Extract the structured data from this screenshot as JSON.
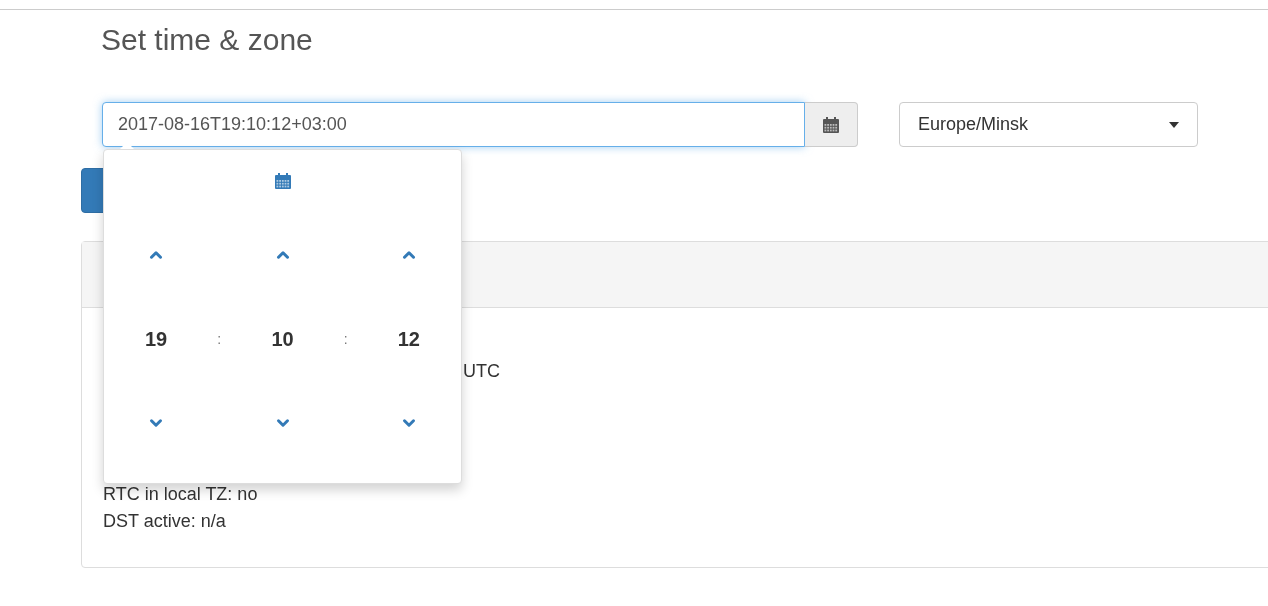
{
  "title": "Set time & zone",
  "datetime": {
    "value": "2017-08-16T19:10:12+03:00"
  },
  "timezone": {
    "value": "Europe/Minsk"
  },
  "picker": {
    "units": [
      "19",
      "10",
      "12"
    ],
    "separator": ":"
  },
  "panel": {
    "lines": [
      {
        "kind": "covered",
        "text": "UTC"
      },
      {
        "kind": "full",
        "text": "RTC in local TZ: no"
      },
      {
        "kind": "full",
        "text": "DST active: n/a"
      }
    ]
  }
}
